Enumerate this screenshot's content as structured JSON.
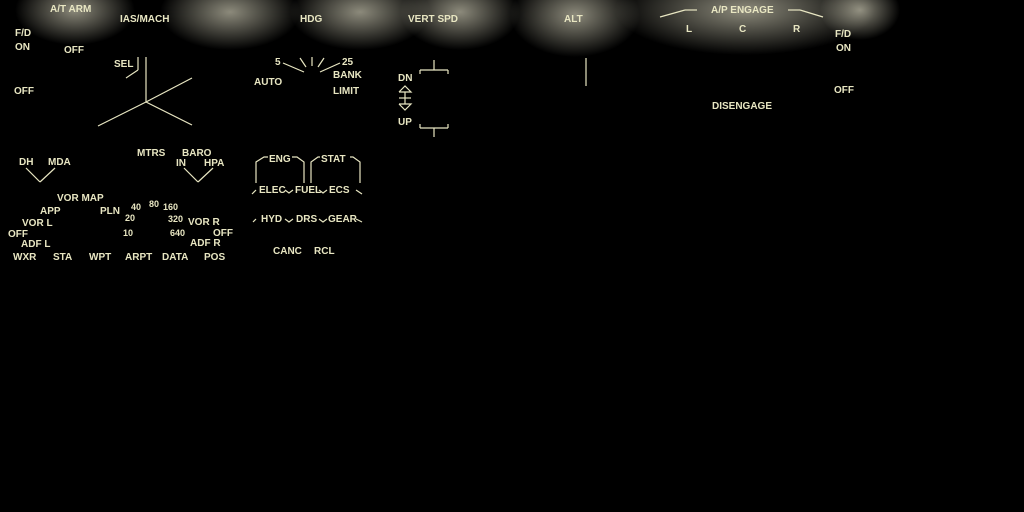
{
  "colors": {
    "background": "#000000",
    "label": "#e8e6c2",
    "glow": "#fffbe0"
  },
  "left_fd": {
    "title": "F/D",
    "on": "ON",
    "off": "OFF"
  },
  "right_fd": {
    "title": "F/D",
    "on": "ON",
    "off": "OFF"
  },
  "autothrottle": {
    "arm_label": "A/T ARM",
    "off_label": "OFF"
  },
  "speed": {
    "title": "IAS/MACH",
    "sel_label": "SEL"
  },
  "heading": {
    "title": "HDG",
    "bank_5": "5",
    "bank_25": "25",
    "auto_label": "AUTO",
    "bank_label": "BANK",
    "limit_label": "LIMIT"
  },
  "vertical_speed": {
    "title": "VERT SPD",
    "dn_label": "DN",
    "up_label": "UP"
  },
  "altitude": {
    "title": "ALT"
  },
  "autopilot": {
    "title": "A/P ENGAGE",
    "left": "L",
    "center": "C",
    "right": "R",
    "disengage": "DISENGAGE"
  },
  "minimums": {
    "dh": "DH",
    "mda": "MDA",
    "mtrs": "MTRS",
    "baro": "BARO",
    "in": "IN",
    "hpa": "HPA"
  },
  "efis": {
    "mode_vor_map": "VOR MAP",
    "mode_app": "APP",
    "mode_pln": "PLN",
    "vor_l": "VOR L",
    "off_l": "OFF",
    "adf_l": "ADF L",
    "range_10": "10",
    "range_20": "20",
    "range_40": "40",
    "range_80": "80",
    "range_160": "160",
    "range_320": "320",
    "range_640": "640",
    "vor_r": "VOR R",
    "off_r": "OFF",
    "adf_r": "ADF R",
    "map_buttons": [
      "WXR",
      "STA",
      "WPT",
      "ARPT",
      "DATA",
      "POS"
    ]
  },
  "eicas": {
    "eng": "ENG",
    "stat": "STAT",
    "elec": "ELEC",
    "fuel": "FUEL",
    "ecs": "ECS",
    "hyd": "HYD",
    "drs": "DRS",
    "gear": "GEAR",
    "canc": "CANC",
    "rcl": "RCL"
  }
}
